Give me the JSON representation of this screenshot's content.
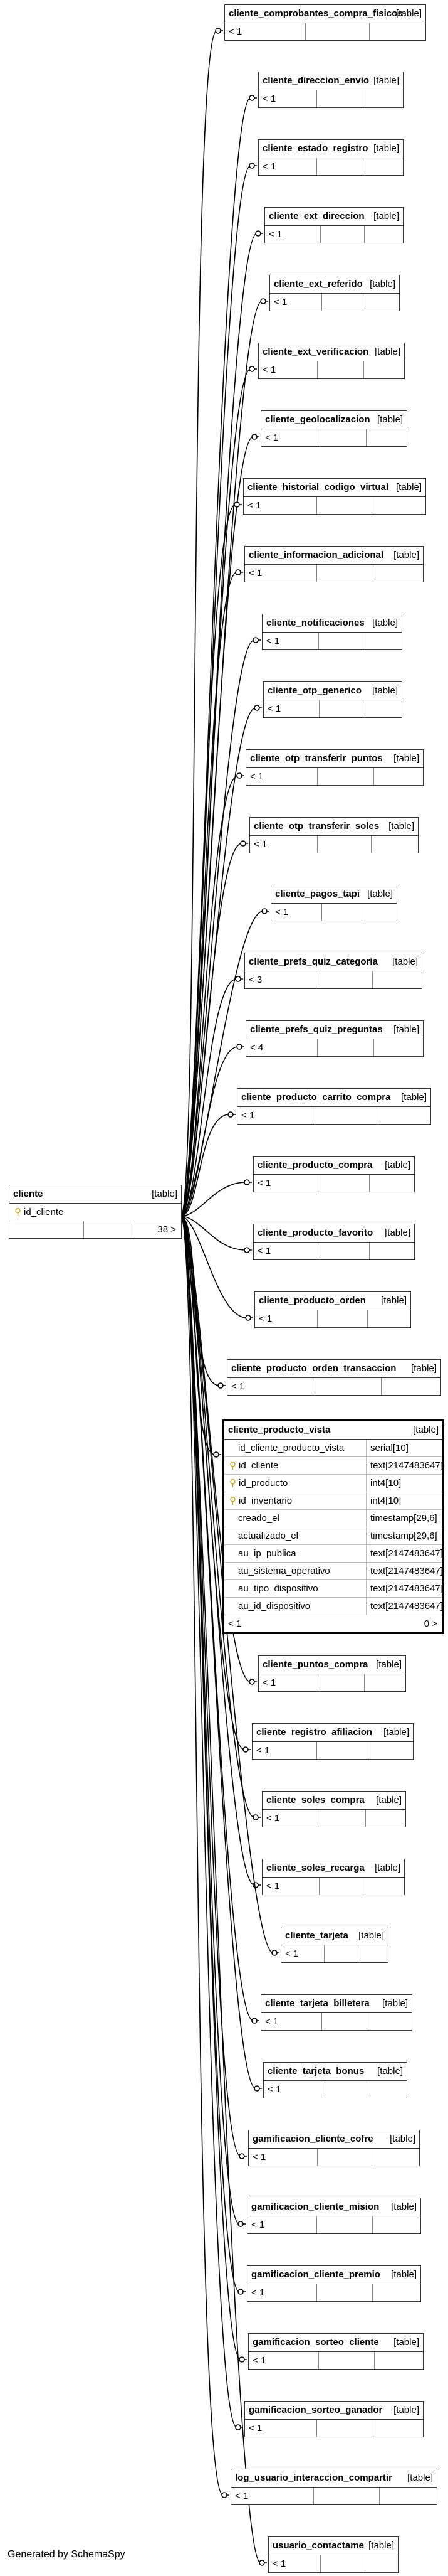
{
  "tables": [
    {
      "name": "cliente_comprobantes_compra_fisicos",
      "kind": "[table]",
      "left": "< 1",
      "right": ""
    },
    {
      "name": "cliente_direccion_envio",
      "kind": "[table]",
      "left": "< 1",
      "right": ""
    },
    {
      "name": "cliente_estado_registro",
      "kind": "[table]",
      "left": "< 1",
      "right": ""
    },
    {
      "name": "cliente_ext_direccion",
      "kind": "[table]",
      "left": "< 1",
      "right": ""
    },
    {
      "name": "cliente_ext_referido",
      "kind": "[table]",
      "left": "< 1",
      "right": ""
    },
    {
      "name": "cliente_ext_verificacion",
      "kind": "[table]",
      "left": "< 1",
      "right": ""
    },
    {
      "name": "cliente_geolocalizacion",
      "kind": "[table]",
      "left": "< 1",
      "right": ""
    },
    {
      "name": "cliente_historial_codigo_virtual",
      "kind": "[table]",
      "left": "< 1",
      "right": ""
    },
    {
      "name": "cliente_informacion_adicional",
      "kind": "[table]",
      "left": "< 1",
      "right": ""
    },
    {
      "name": "cliente_notificaciones",
      "kind": "[table]",
      "left": "< 1",
      "right": ""
    },
    {
      "name": "cliente_otp_generico",
      "kind": "[table]",
      "left": "< 1",
      "right": ""
    },
    {
      "name": "cliente_otp_transferir_puntos",
      "kind": "[table]",
      "left": "< 1",
      "right": ""
    },
    {
      "name": "cliente_otp_transferir_soles",
      "kind": "[table]",
      "left": "< 1",
      "right": ""
    },
    {
      "name": "cliente_pagos_tapi",
      "kind": "[table]",
      "left": "< 1",
      "right": ""
    },
    {
      "name": "cliente_prefs_quiz_categoria",
      "kind": "[table]",
      "left": "< 3",
      "right": ""
    },
    {
      "name": "cliente_prefs_quiz_preguntas",
      "kind": "[table]",
      "left": "< 4",
      "right": ""
    },
    {
      "name": "cliente_producto_carrito_compra",
      "kind": "[table]",
      "left": "< 1",
      "right": ""
    },
    {
      "name": "cliente_producto_compra",
      "kind": "[table]",
      "left": "< 1",
      "right": ""
    },
    {
      "name": "cliente_producto_favorito",
      "kind": "[table]",
      "left": "< 1",
      "right": ""
    },
    {
      "name": "cliente_producto_orden",
      "kind": "[table]",
      "left": "< 1",
      "right": ""
    },
    {
      "name": "cliente_producto_orden_transaccion",
      "kind": "[table]",
      "left": "< 1",
      "right": ""
    },
    {
      "name": "cliente_puntos_compra",
      "kind": "[table]",
      "left": "< 1",
      "right": ""
    },
    {
      "name": "cliente_registro_afiliacion",
      "kind": "[table]",
      "left": "< 1",
      "right": ""
    },
    {
      "name": "cliente_soles_compra",
      "kind": "[table]",
      "left": "< 1",
      "right": ""
    },
    {
      "name": "cliente_soles_recarga",
      "kind": "[table]",
      "left": "< 1",
      "right": ""
    },
    {
      "name": "cliente_tarjeta",
      "kind": "[table]",
      "left": "< 1",
      "right": ""
    },
    {
      "name": "cliente_tarjeta_billetera",
      "kind": "[table]",
      "left": "< 1",
      "right": ""
    },
    {
      "name": "cliente_tarjeta_bonus",
      "kind": "[table]",
      "left": "< 1",
      "right": ""
    },
    {
      "name": "gamificacion_cliente_cofre",
      "kind": "[table]",
      "left": "< 1",
      "right": ""
    },
    {
      "name": "gamificacion_cliente_mision",
      "kind": "[table]",
      "left": "< 1",
      "right": ""
    },
    {
      "name": "gamificacion_cliente_premio",
      "kind": "[table]",
      "left": "< 1",
      "right": ""
    },
    {
      "name": "gamificacion_sorteo_cliente",
      "kind": "[table]",
      "left": "< 1",
      "right": ""
    },
    {
      "name": "gamificacion_sorteo_ganador",
      "kind": "[table]",
      "left": "< 1",
      "right": ""
    },
    {
      "name": "log_usuario_interaccion_compartir",
      "kind": "[table]",
      "left": "< 1",
      "right": ""
    },
    {
      "name": "usuario_contactame",
      "kind": "[table]",
      "left": "< 1",
      "right": ""
    }
  ],
  "cliente": {
    "name": "cliente",
    "kind": "[table]",
    "pk": "id_cliente",
    "left": "",
    "right": "38 >"
  },
  "producto_vista": {
    "name": "cliente_producto_vista",
    "kind": "[table]",
    "columns": [
      {
        "name": "id_cliente_producto_vista",
        "type": "serial[10]",
        "key": ""
      },
      {
        "name": "id_cliente",
        "type": "text[2147483647]",
        "key": "fk"
      },
      {
        "name": "id_producto",
        "type": "int4[10]",
        "key": "fk"
      },
      {
        "name": "id_inventario",
        "type": "int4[10]",
        "key": "fk"
      },
      {
        "name": "creado_el",
        "type": "timestamp[29,6]",
        "key": ""
      },
      {
        "name": "actualizado_el",
        "type": "timestamp[29,6]",
        "key": ""
      },
      {
        "name": "au_ip_publica",
        "type": "text[2147483647]",
        "key": ""
      },
      {
        "name": "au_sistema_operativo",
        "type": "text[2147483647]",
        "key": ""
      },
      {
        "name": "au_tipo_dispositivo",
        "type": "text[2147483647]",
        "key": ""
      },
      {
        "name": "au_id_dispositivo",
        "type": "text[2147483647]",
        "key": ""
      }
    ],
    "left": "< 1",
    "right": "0 >"
  },
  "footer": "Generated by SchemaSpy",
  "colors": {
    "line": "#000000",
    "key": "#d4a000"
  }
}
